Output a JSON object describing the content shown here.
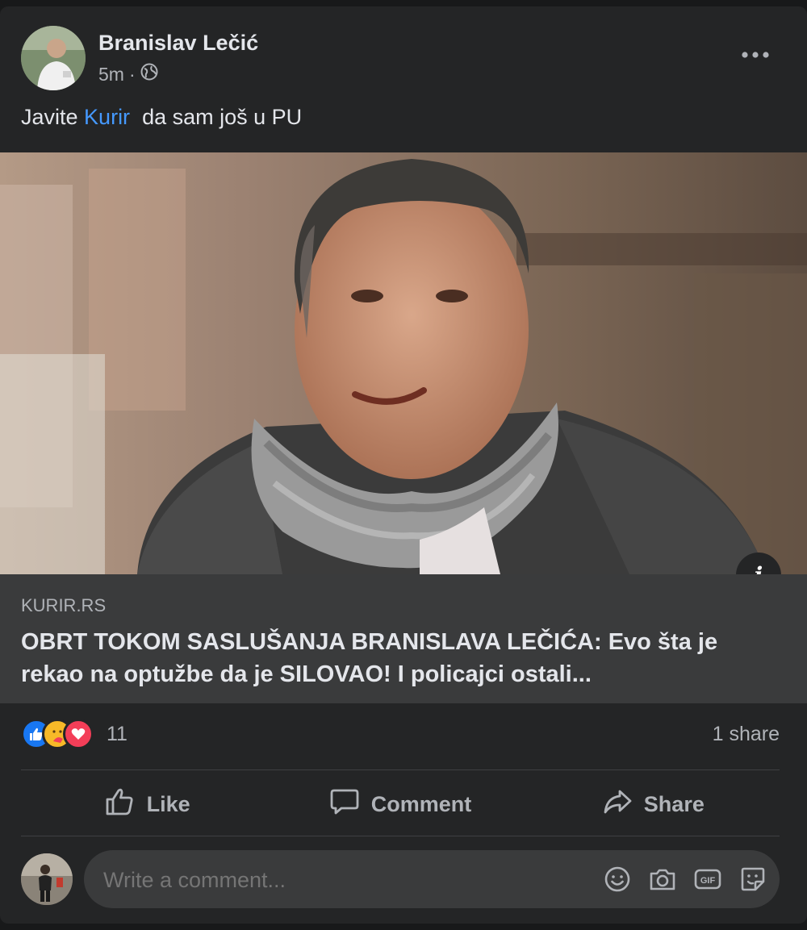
{
  "post": {
    "author": "Branislav Lečić",
    "time": "5m",
    "separator": "·",
    "text_before": "Javite ",
    "mention": "Kurir",
    "text_after": "  da sam još u PU"
  },
  "link": {
    "domain": "KURIR.RS",
    "headline": "OBRT TOKOM SASLUŠANJA BRANISLAVA LEČIĆA: Evo šta je rekao na optužbe da je SILOVAO! I policajci ostali...",
    "info_label": "i"
  },
  "stats": {
    "reaction_count": "11",
    "shares": "1 share",
    "reactions": [
      "like-icon",
      "care-icon",
      "love-icon"
    ]
  },
  "actions": {
    "like": "Like",
    "comment": "Comment",
    "share": "Share"
  },
  "composer": {
    "placeholder": "Write a comment..."
  },
  "colors": {
    "card_bg": "#242526",
    "link_bg": "#3a3b3c",
    "mention": "#4599ff",
    "like_blue": "#1877f2",
    "love_red": "#f33e58",
    "care_yellow": "#f7b928"
  }
}
